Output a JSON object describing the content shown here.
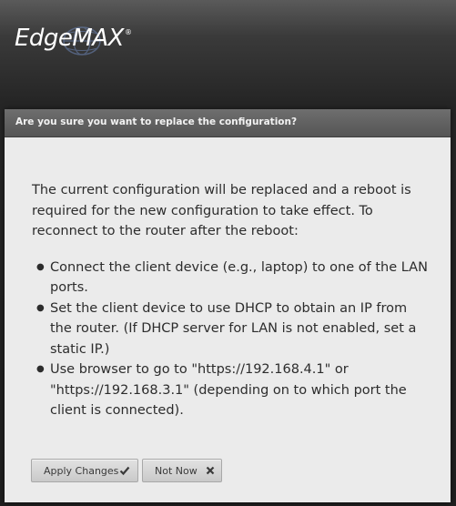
{
  "header": {
    "brand": "EdgeMAX",
    "trademark": "®"
  },
  "dialog": {
    "title": "Are you sure you want to replace the configuration?",
    "intro": "The current configuration will be replaced and a reboot is required for the new configuration to take effect. To reconnect to the router after the reboot:",
    "steps": [
      "Connect the client device (e.g., laptop) to one of the LAN ports.",
      "Set the client device to use DHCP to obtain an IP from the router. (If DHCP server for LAN is not enabled, set a static IP.)",
      "Use browser to go to \"https://192.168.4.1\" or \"https://192.168.3.1\" (depending on to which port the client is connected)."
    ],
    "buttons": {
      "apply_label": "Apply Changes",
      "apply_icon": "checkmark-icon",
      "not_now_label": "Not Now",
      "not_now_icon": "close-x-icon"
    }
  },
  "colors": {
    "header_bg": "#262626",
    "titlebar_bg": "#5e5e5e",
    "dialog_bg": "#ebebeb",
    "body_text": "#2c2c2c",
    "button_bg": "#d4d4d4"
  }
}
